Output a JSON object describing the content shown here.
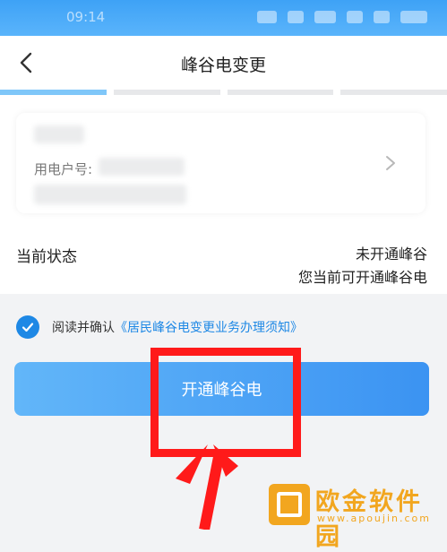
{
  "status_bar": {
    "time": "09:14"
  },
  "header": {
    "title": "峰谷电变更"
  },
  "progress": {
    "total_steps": 4,
    "current_step": 1
  },
  "account_card": {
    "account_label": "用电户号:"
  },
  "status": {
    "label": "当前状态",
    "value_line1": "未开通峰谷",
    "value_line2": "您当前可开通峰谷电"
  },
  "agreement": {
    "checked": true,
    "prefix": "阅读并确认",
    "link": "《居民峰谷电变更业务办理须知》"
  },
  "primary_button": {
    "label": "开通峰谷电"
  },
  "watermark": {
    "name": "欧金软件园",
    "url": "www.apoujin.com"
  },
  "colors": {
    "accent": "#1e88e5",
    "button_start": "#62b6f9",
    "button_end": "#3b93f2",
    "highlight": "#ff1a1a",
    "watermark": "#f2a61f"
  }
}
